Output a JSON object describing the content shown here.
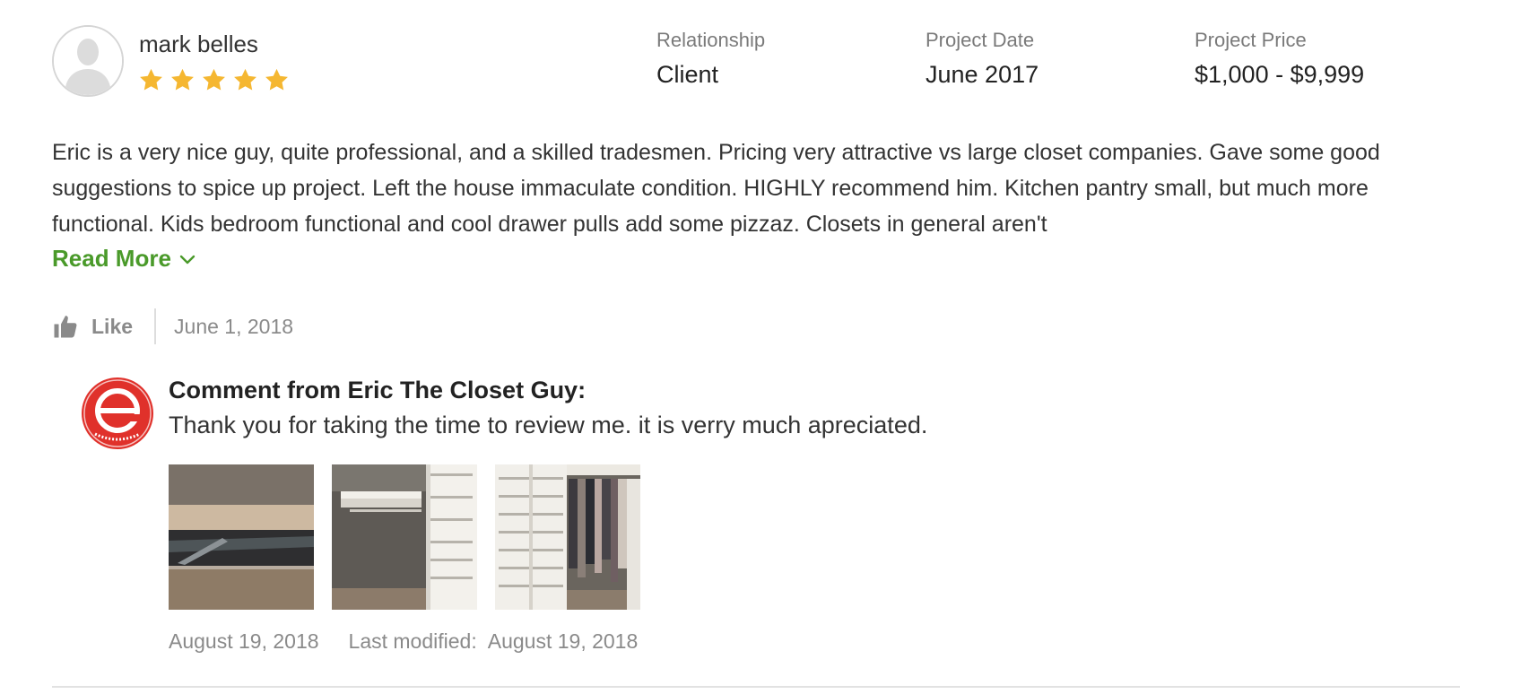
{
  "reviewer": {
    "name": "mark belles",
    "rating": 5,
    "avatar_icon": "user-silhouette-icon",
    "star_icon": "star-icon",
    "star_color": "#f5b731"
  },
  "meta": {
    "relationship_label": "Relationship",
    "relationship_value": "Client",
    "date_label": "Project Date",
    "date_value": "June 2017",
    "price_label": "Project Price",
    "price_value": "$1,000 - $9,999"
  },
  "review": {
    "body": "Eric is a very nice guy, quite professional, and a skilled tradesmen. Pricing very attractive vs large closet companies. Gave some good suggestions to spice up project. Left the house immaculate condition. HIGHLY recommend him. Kitchen pantry small, but much more functional. Kids bedroom functional and cool drawer pulls add some pizzaz. Closets in general aren't",
    "read_more_label": "Read More",
    "read_more_color": "#4a9a2a",
    "like_label": "Like",
    "date": "June 1, 2018"
  },
  "comment": {
    "heading": "Comment from Eric The Closet Guy:",
    "text": "Thank you for taking the time to review me. it is verry much apreciated.",
    "logo_color": "#e0312b",
    "photos": [
      {
        "name": "closet-photo-1"
      },
      {
        "name": "closet-photo-2"
      },
      {
        "name": "closet-photo-3"
      }
    ],
    "posted_date": "August 19, 2018",
    "last_modified_label": "Last modified:",
    "last_modified_date": "August 19, 2018"
  }
}
